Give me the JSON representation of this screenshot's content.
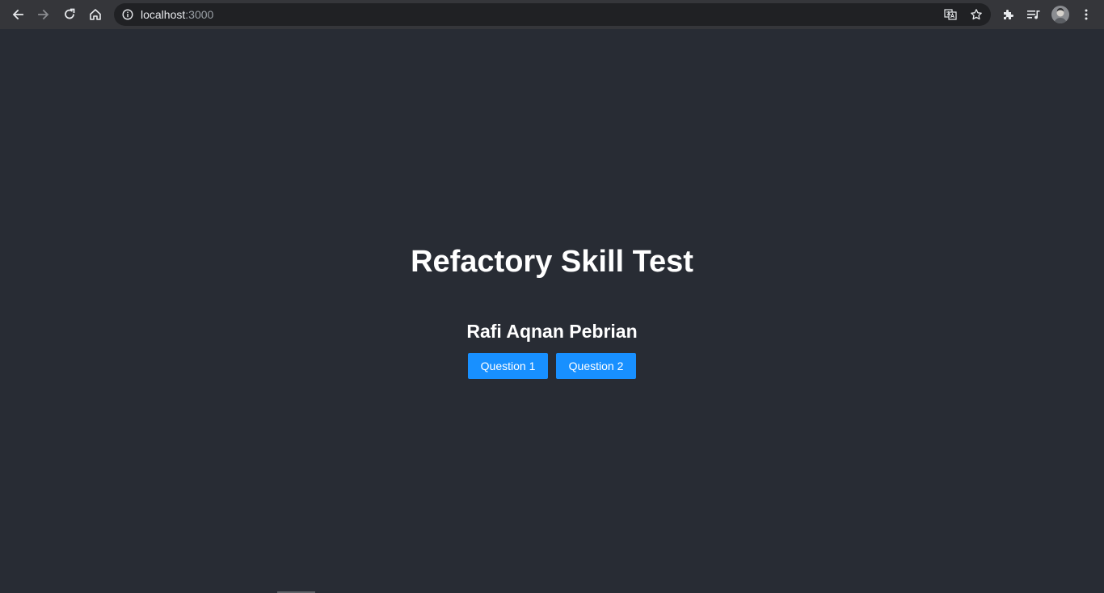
{
  "browser": {
    "url_host": "localhost",
    "url_port": ":3000",
    "icons": {
      "back": "arrow-left-icon",
      "forward": "arrow-right-icon",
      "reload": "reload-icon",
      "home": "home-icon",
      "site_info": "info-icon",
      "translate": "translate-icon",
      "bookmark": "star-icon",
      "extensions": "puzzle-icon",
      "reading_list": "reading-list-icon",
      "profile": "avatar",
      "menu": "kebab-menu-icon"
    }
  },
  "page": {
    "title": "Refactory Skill Test",
    "author": "Rafi Aqnan Pebrian",
    "buttons": {
      "question1": "Question 1",
      "question2": "Question 2"
    }
  },
  "colors": {
    "background": "#282c34",
    "primary": "#1890ff",
    "text": "#ffffff"
  }
}
